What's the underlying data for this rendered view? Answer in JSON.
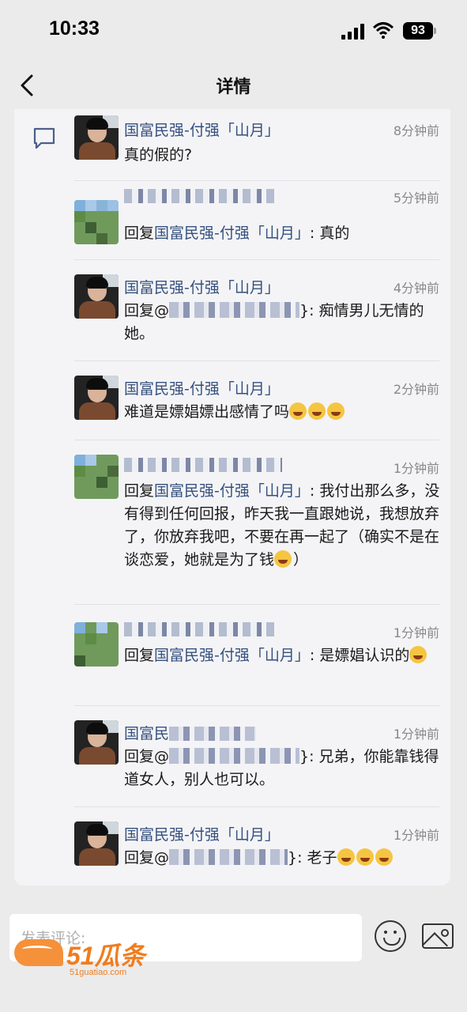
{
  "status": {
    "time": "10:33",
    "battery": "93"
  },
  "nav": {
    "title": "详情"
  },
  "comments": [
    {
      "name": "国富民强-付强「山月」",
      "time": "8分钟前",
      "content": "真的假的?"
    },
    {
      "name": "",
      "time": "5分钟前",
      "prefix": "回复",
      "target": "国富民强-付强「山月」",
      "text": ": 真的"
    },
    {
      "name": "国富民强-付强「山月」",
      "time": "4分钟前",
      "prefix": "回复@",
      "suffix": "}: 痴情男儿无情的她。"
    },
    {
      "name": "国富民强-付强「山月」",
      "time": "2分钟前",
      "content": "难道是嫖娼嫖出感情了吗"
    },
    {
      "name": "",
      "time": "1分钟前",
      "prefix": "回复",
      "target": "国富民强-付强「山月」",
      "text": ": 我付出那么多，没有得到任何回报，昨天我一直跟她说，我想放弃了，你放弃我吧，不要在再一起了（确实不是在谈恋爱，她就是为了钱",
      "tail": "）"
    },
    {
      "name": "",
      "time": "1分钟前",
      "prefix": "回复",
      "target": "国富民强-付强「山月」",
      "text": ": 是嫖娼认识的"
    },
    {
      "name": "国富民",
      "time": "1分钟前",
      "prefix": "回复@",
      "suffix": "}: 兄弟，你能靠钱得道女人，别人也可以。"
    },
    {
      "name": "国富民强-付强「山月」",
      "time": "1分钟前",
      "prefix": "回复@",
      "suffix": "}: 老子"
    }
  ],
  "input": {
    "placeholder": "发表评论:"
  },
  "watermark": {
    "brand": "51瓜条",
    "url": "51guatiao.com"
  },
  "colors": {
    "name_link": "#35507e",
    "background": "#ebebeb",
    "card": "#f4f4f6"
  }
}
